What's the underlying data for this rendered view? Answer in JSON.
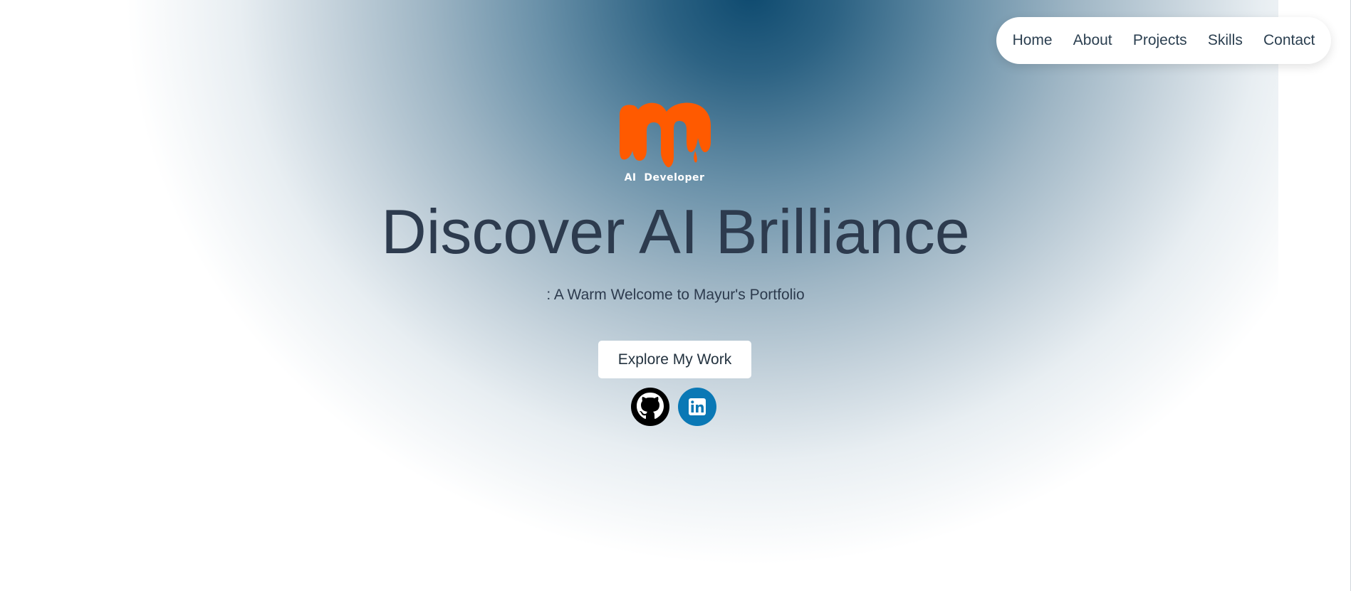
{
  "nav": {
    "items": [
      {
        "label": "Home"
      },
      {
        "label": "About"
      },
      {
        "label": "Projects"
      },
      {
        "label": "Skills"
      },
      {
        "label": "Contact"
      }
    ]
  },
  "logo": {
    "letter": "m",
    "subtitle": "AI  Developer",
    "color": "#ff5a00"
  },
  "hero": {
    "title": "Discover AI Brilliance",
    "subtitle": ": A Warm Welcome to Mayur's Portfolio",
    "cta_label": "Explore My Work"
  },
  "social": {
    "items": [
      {
        "icon": "github-icon",
        "color": "#000000"
      },
      {
        "icon": "linkedin-icon",
        "color": "#0a78b5"
      }
    ]
  },
  "colors": {
    "glow_center": "#0e4a6f",
    "text": "#2d3b4e",
    "background": "#ffffff"
  }
}
